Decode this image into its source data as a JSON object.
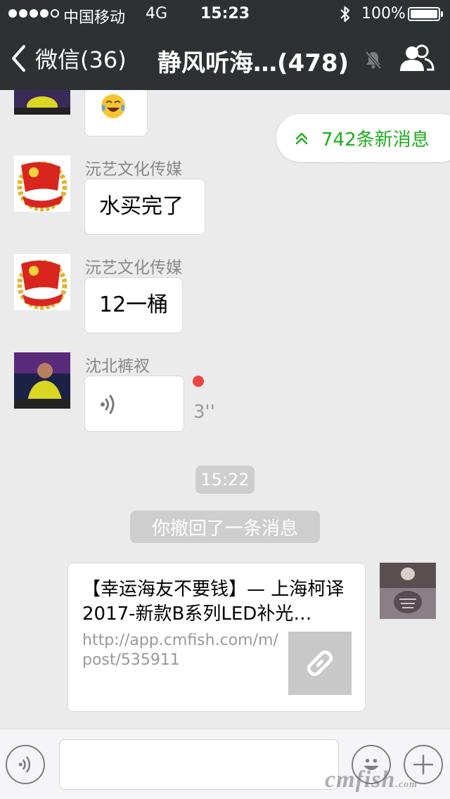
{
  "status_bar": {
    "carrier": "中国移动",
    "network": "4G",
    "time": "15:23",
    "battery": "100%",
    "battery_level": 1.0,
    "signal_bars": 4,
    "signal_max": 5
  },
  "nav": {
    "back_label": "微信(36)",
    "title": "静风听海…(478)"
  },
  "chat": {
    "new_messages": "742条新消息",
    "messages": [
      {
        "sender": "沅艺文化传媒",
        "text": "水买完了"
      },
      {
        "sender": "沅艺文化传媒",
        "text": "12一桶"
      },
      {
        "sender": "沈北裤衩",
        "voice_duration": "3''"
      }
    ],
    "timestamp": "15:22",
    "system_notice": "你撤回了一条消息",
    "link_card": {
      "title": "【幸运海友不要钱】— 上海柯译2017-新款B系列LED补光…",
      "url": "http://app.cmfish.com/m/post/535911"
    }
  },
  "input": {
    "value": ""
  },
  "watermark": {
    "text": "cmfish",
    "suffix": ".com"
  },
  "colors": {
    "header_bg": "#2e3132",
    "chat_bg": "#ebebeb",
    "accent_green": "#1aad19",
    "unread_red": "#ea4444"
  },
  "icons": {
    "back": "chevron-left-icon",
    "mute": "bell-slash-icon",
    "members": "group-icon",
    "new_messages": "double-chevron-up-icon",
    "voice": "voice-wave-icon",
    "link": "link-icon",
    "emoji": "smile-icon",
    "add": "plus-icon"
  }
}
